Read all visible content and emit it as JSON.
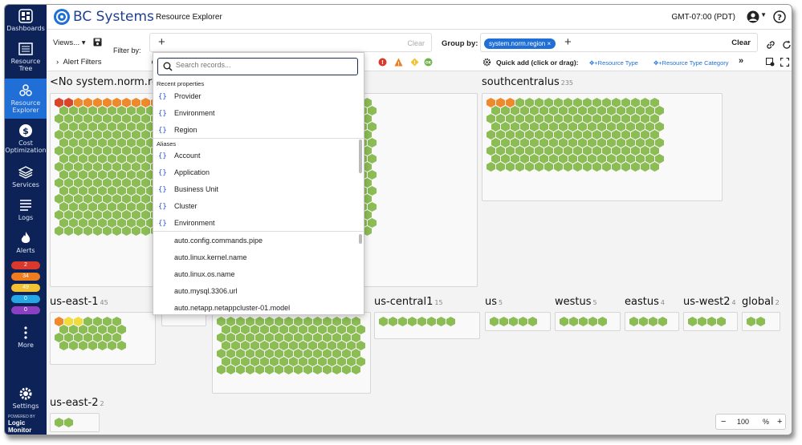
{
  "app": {
    "brand": "BC Systems",
    "page_title": "Resource Explorer",
    "timezone": "GMT-07:00 (PDT)"
  },
  "sidebar": {
    "items": [
      {
        "label": "Dashboards",
        "icon": "dashboards-icon"
      },
      {
        "label": "Resource Tree",
        "icon": "resource-tree-icon"
      },
      {
        "label": "Resource Explorer",
        "icon": "resource-explorer-icon",
        "active": true
      },
      {
        "label": "Cost Optimization",
        "icon": "dollar-icon"
      },
      {
        "label": "Services",
        "icon": "layers-icon"
      },
      {
        "label": "Logs",
        "icon": "logs-icon"
      },
      {
        "label": "Alerts",
        "icon": "flame-icon"
      },
      {
        "label": "More",
        "icon": "more-vertical-icon"
      }
    ],
    "alert_counts": [
      {
        "value": "2",
        "color": "#d9382c"
      },
      {
        "value": "34",
        "color": "#ee7d22"
      },
      {
        "value": "49",
        "color": "#f2c233"
      },
      {
        "value": "0",
        "color": "#27a6e5"
      },
      {
        "value": "0",
        "color": "#8b3fc2"
      }
    ],
    "settings_label": "Settings",
    "powered_by": "POWERED BY",
    "powered_name": "Logic Monitor"
  },
  "toolbar": {
    "views_label": "Views...",
    "filter_label": "Filter by:",
    "filter_clear": "Clear",
    "group_label": "Group by:",
    "group_chip": "system.norm.region",
    "group_clear": "Clear",
    "alert_filters": "Alert Filters",
    "quick_add": "Quick add (click or drag):",
    "quick_items": [
      "+Resource Type",
      "+Resource Type Category"
    ]
  },
  "dropdown": {
    "search_placeholder": "Search records...",
    "recent_header": "Recent properties",
    "recent": [
      "Provider",
      "Environment",
      "Region"
    ],
    "aliases_header": "Aliases",
    "aliases": [
      "Account",
      "Application",
      "Business Unit",
      "Cluster",
      "Environment"
    ],
    "properties": [
      "auto.config.commands.pipe",
      "auto.linux.kernel.name",
      "auto.linux.os.name",
      "auto.mysql.3306.url",
      "auto.netapp.netappcluster-01.model"
    ]
  },
  "groups": [
    {
      "name": "<No system.norm.region>",
      "count": ""
    },
    {
      "name": "southcentralus",
      "count": "235"
    },
    {
      "name": "us-east-1",
      "count": "45"
    },
    {
      "name": "us-central1",
      "count": "15"
    },
    {
      "name": "us",
      "count": "5"
    },
    {
      "name": "westus",
      "count": "5"
    },
    {
      "name": "eastus",
      "count": "4"
    },
    {
      "name": "us-west2",
      "count": "4"
    },
    {
      "name": "global",
      "count": "2"
    },
    {
      "name": "us-east-2",
      "count": "2"
    }
  ],
  "colors": {
    "green": "#8cbd55",
    "orange": "#ef8a2c",
    "red": "#d9452b",
    "yellow": "#f0dc3c",
    "nav": "#0d2358",
    "accent": "#1f6fd6"
  },
  "zoom": {
    "minus": "−",
    "value": "100",
    "unit": "%",
    "plus": "+"
  }
}
